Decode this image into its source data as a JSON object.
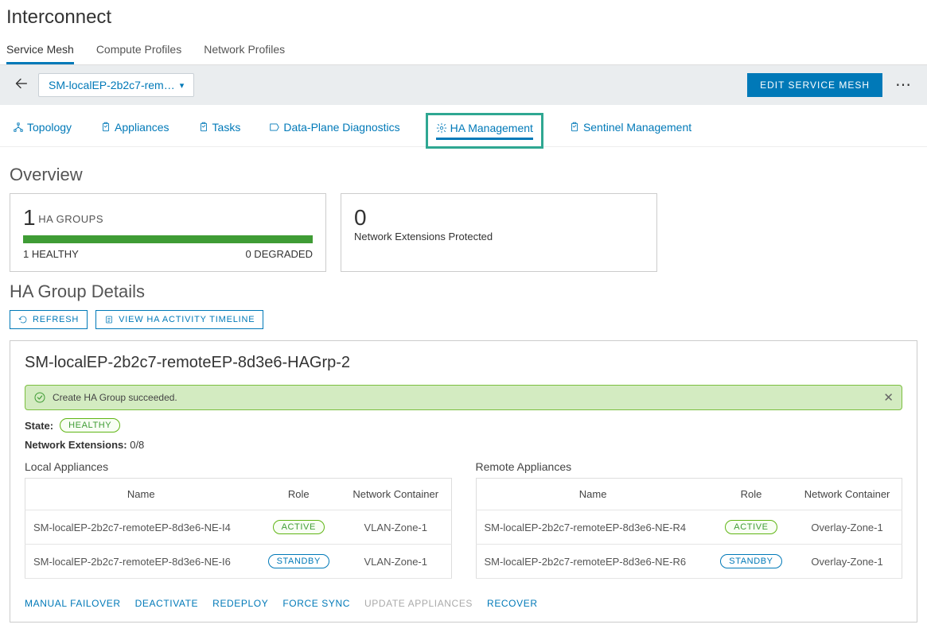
{
  "page": {
    "title": "Interconnect"
  },
  "top_tabs": {
    "items": [
      "Service Mesh",
      "Compute Profiles",
      "Network Profiles"
    ],
    "active_index": 0
  },
  "subheader": {
    "service_mesh_label": "SM-localEP-2b2c7-rem…",
    "edit_button": "EDIT SERVICE MESH"
  },
  "sub_tabs": {
    "items": [
      "Topology",
      "Appliances",
      "Tasks",
      "Data-Plane Diagnostics",
      "HA Management",
      "Sentinel Management"
    ],
    "active_index": 4
  },
  "overview": {
    "title": "Overview",
    "card1": {
      "count": "1",
      "label": "HA GROUPS",
      "healthy": "1 HEALTHY",
      "degraded": "0 DEGRADED"
    },
    "card2": {
      "count": "0",
      "label": "Network Extensions Protected"
    }
  },
  "details": {
    "title": "HA Group Details",
    "refresh_btn": "REFRESH",
    "timeline_btn": "VIEW HA ACTIVITY TIMELINE"
  },
  "group": {
    "name": "SM-localEP-2b2c7-remoteEP-8d3e6-HAGrp-2",
    "alert": "Create HA Group succeeded.",
    "state_label": "State:",
    "state_badge": "HEALTHY",
    "ne_label": "Network Extensions:",
    "ne_value": "0/8",
    "local_title": "Local Appliances",
    "remote_title": "Remote Appliances",
    "columns": {
      "name": "Name",
      "role": "Role",
      "container": "Network Container"
    },
    "local": [
      {
        "name": "SM-localEP-2b2c7-remoteEP-8d3e6-NE-I4",
        "role": "ACTIVE",
        "container": "VLAN-Zone-1"
      },
      {
        "name": "SM-localEP-2b2c7-remoteEP-8d3e6-NE-I6",
        "role": "STANDBY",
        "container": "VLAN-Zone-1"
      }
    ],
    "remote": [
      {
        "name": "SM-localEP-2b2c7-remoteEP-8d3e6-NE-R4",
        "role": "ACTIVE",
        "container": "Overlay-Zone-1"
      },
      {
        "name": "SM-localEP-2b2c7-remoteEP-8d3e6-NE-R6",
        "role": "STANDBY",
        "container": "Overlay-Zone-1"
      }
    ],
    "actions": {
      "manual_failover": "MANUAL FAILOVER",
      "deactivate": "DEACTIVATE",
      "redeploy": "REDEPLOY",
      "force_sync": "FORCE SYNC",
      "update_appliances": "UPDATE APPLIANCES",
      "recover": "RECOVER"
    }
  }
}
